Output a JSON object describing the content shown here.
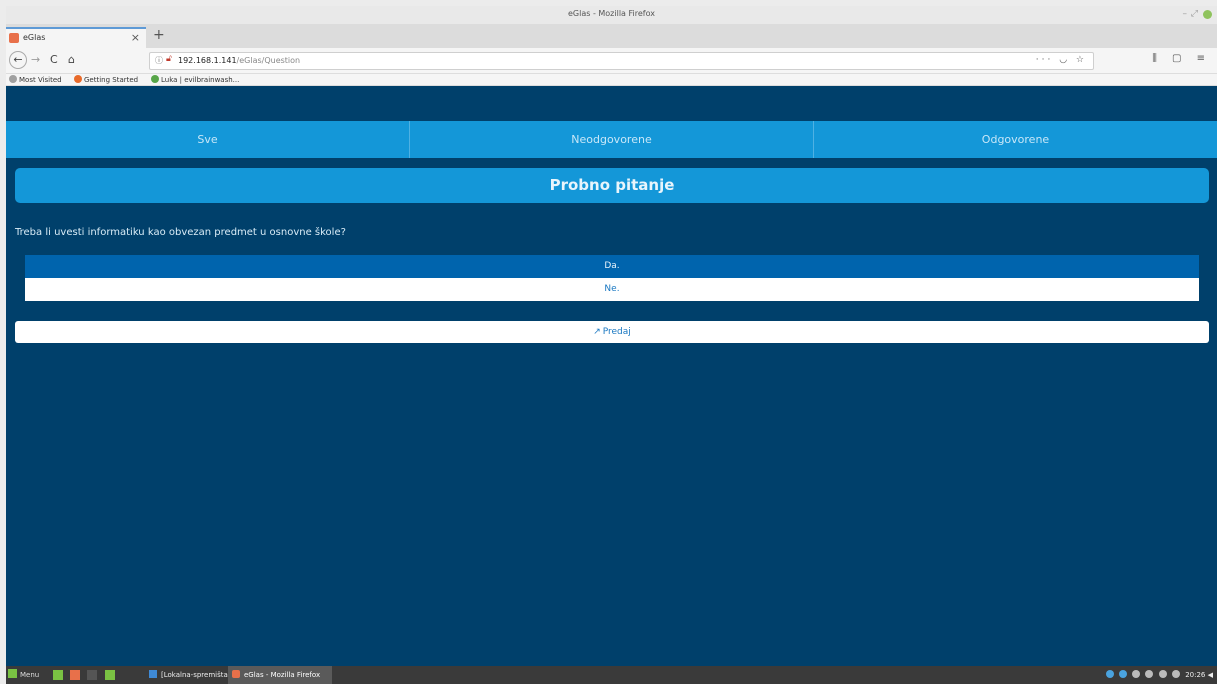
{
  "window": {
    "title": "eGlas - Mozilla Firefox"
  },
  "tab": {
    "label": "eGlas",
    "close_glyph": "×",
    "new_tab_glyph": "+"
  },
  "navbar": {
    "back_glyph": "←",
    "forward_glyph": "→",
    "reload_glyph": "C",
    "home_glyph": "⌂",
    "url_host": "192.168.1.141",
    "url_path": "/eGlas/Question",
    "url_actions": "··· ◡ ☆",
    "toolbar_right": "⫼ ▢ ≡"
  },
  "bookmarks": [
    {
      "label": "Most Visited"
    },
    {
      "label": "Getting Started"
    },
    {
      "label": "Luka | evilbrainwash..."
    }
  ],
  "filters": [
    {
      "label": "Sve"
    },
    {
      "label": "Neodgovorene"
    },
    {
      "label": "Odgovorene"
    }
  ],
  "question": {
    "title": "Probno pitanje",
    "text": "Treba li uvesti informatiku kao obvezan predmet u osnovne škole?"
  },
  "answers": [
    {
      "label": "Da.",
      "selected": true
    },
    {
      "label": "Ne.",
      "selected": false
    }
  ],
  "submit": {
    "label": "Predaj",
    "icon": "share-square-icon"
  },
  "taskbar": {
    "menu_label": "Menu",
    "task1_label": "[Lokalna-spremišta-p...",
    "task2_label": "eGlas - Mozilla Firefox",
    "clock": "20:26"
  },
  "colors": {
    "page_bg": "#00406b",
    "accent": "#1497d8",
    "selected_answer": "#0064ad"
  }
}
